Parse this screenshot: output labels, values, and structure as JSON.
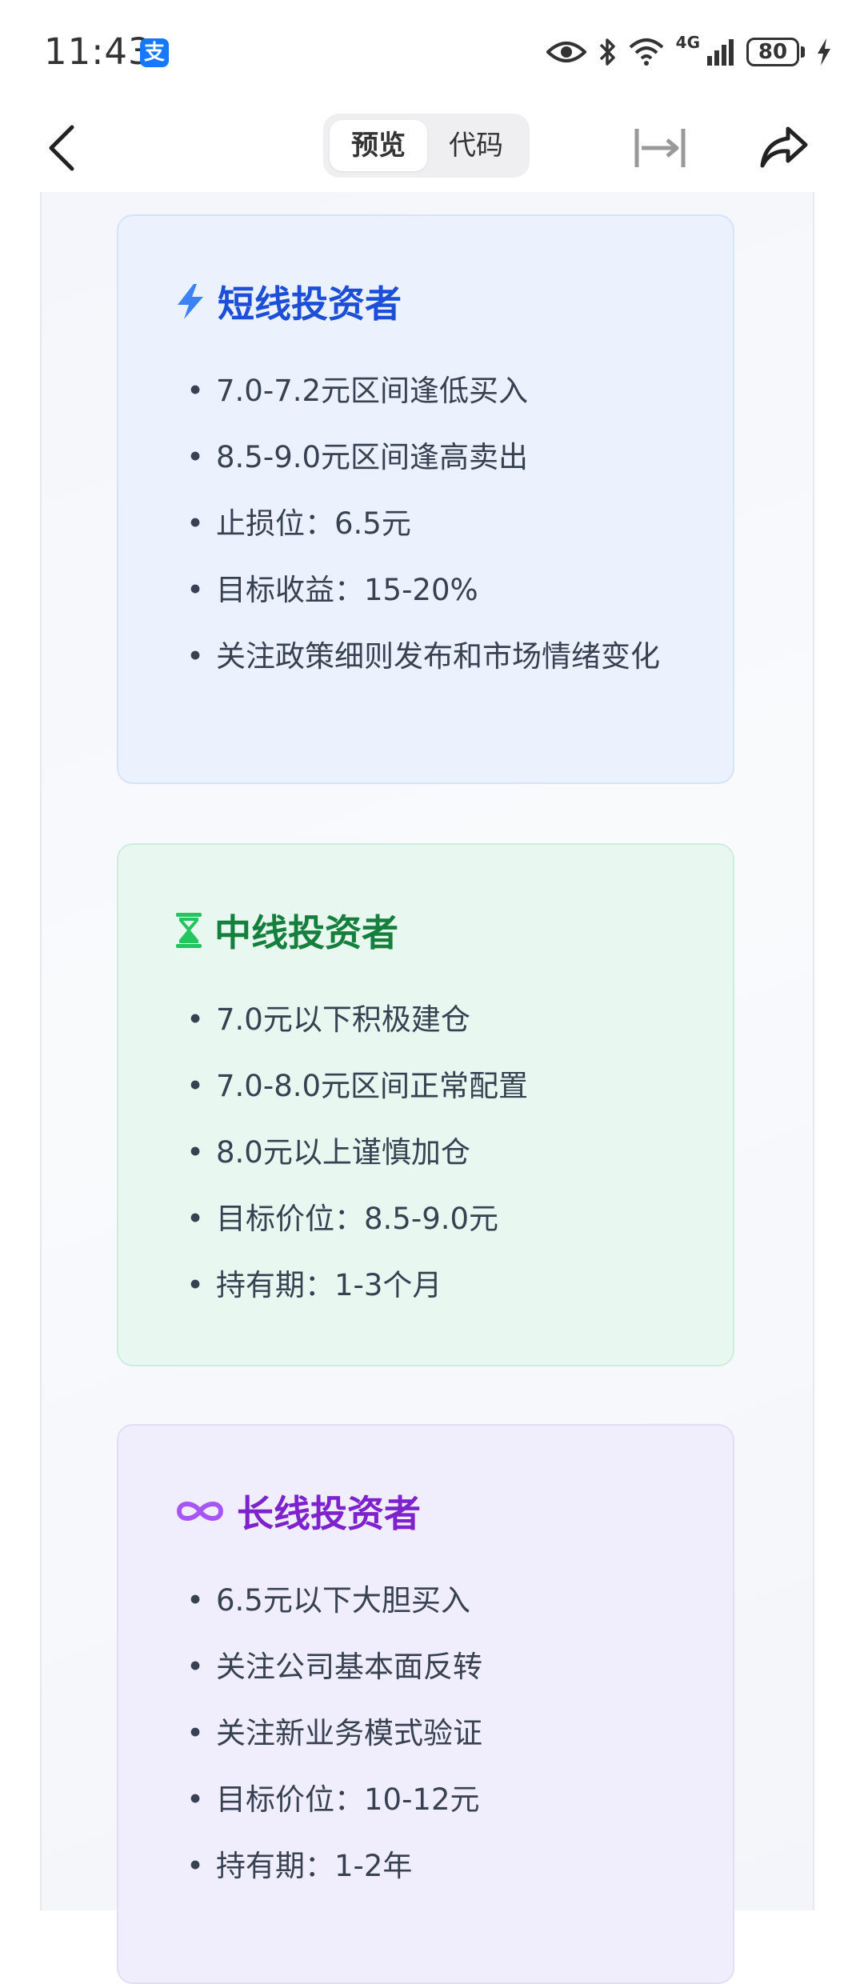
{
  "status_bar": {
    "time": "11:43",
    "pay_icon_glyph": "支",
    "network": "4G",
    "battery": "80",
    "icons": [
      "eye-icon",
      "bluetooth-icon",
      "wifi-icon",
      "signal-icon",
      "battery-icon",
      "charging-icon"
    ]
  },
  "header": {
    "tabs": [
      {
        "label": "预览",
        "active": true
      },
      {
        "label": "代码",
        "active": false
      }
    ]
  },
  "cards": {
    "short": {
      "icon": "lightning-icon",
      "title": "短线投资者",
      "items": [
        "7.0-7.2元区间逢低买入",
        "8.5-9.0元区间逢高卖出",
        "止损位：6.5元",
        "目标收益：15-20%",
        "关注政策细则发布和市场情绪变化"
      ]
    },
    "mid": {
      "icon": "hourglass-icon",
      "title": "中线投资者",
      "items": [
        "7.0元以下积极建仓",
        "7.0-8.0元区间正常配置",
        "8.0元以上谨慎加仓",
        "目标价位：8.5-9.0元",
        "持有期：1-3个月"
      ]
    },
    "long": {
      "icon": "infinity-icon",
      "title": "长线投资者",
      "items": [
        "6.5元以下大胆买入",
        "关注公司基本面反转",
        "关注新业务模式验证",
        "目标价位：10-12元",
        "持有期：1-2年"
      ]
    }
  },
  "colors": {
    "short_accent": "#1d4ed8",
    "mid_accent": "#15803d",
    "long_accent": "#7e22ce"
  }
}
